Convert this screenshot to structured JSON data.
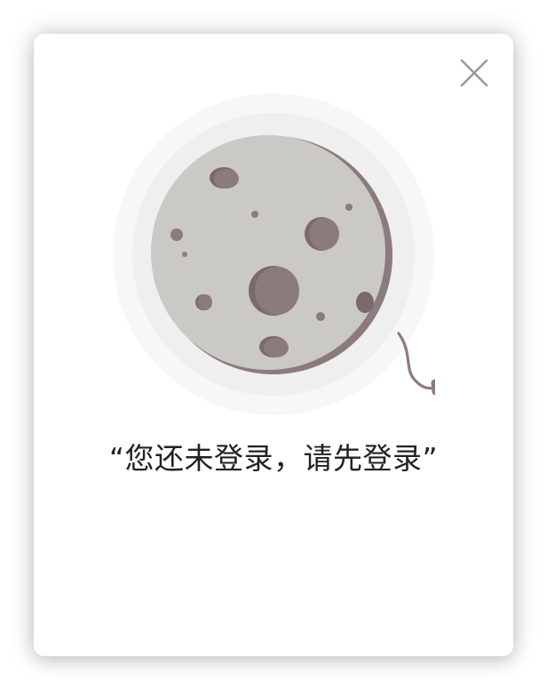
{
  "dialog": {
    "message": "“您还未登录，请先登录”",
    "close_icon": "close-icon",
    "illustration_icon": "unplugged-moon-icon"
  },
  "colors": {
    "halo_outer": "#f7f7f7",
    "halo_inner": "#efefef",
    "moon_shadow": "#8c7b7d",
    "moon_face": "#cbc9c5",
    "crater": "#8c7b7d",
    "crater_dark": "#7a6a6c",
    "close_icon": "#9a9a9a",
    "text": "#222222"
  }
}
